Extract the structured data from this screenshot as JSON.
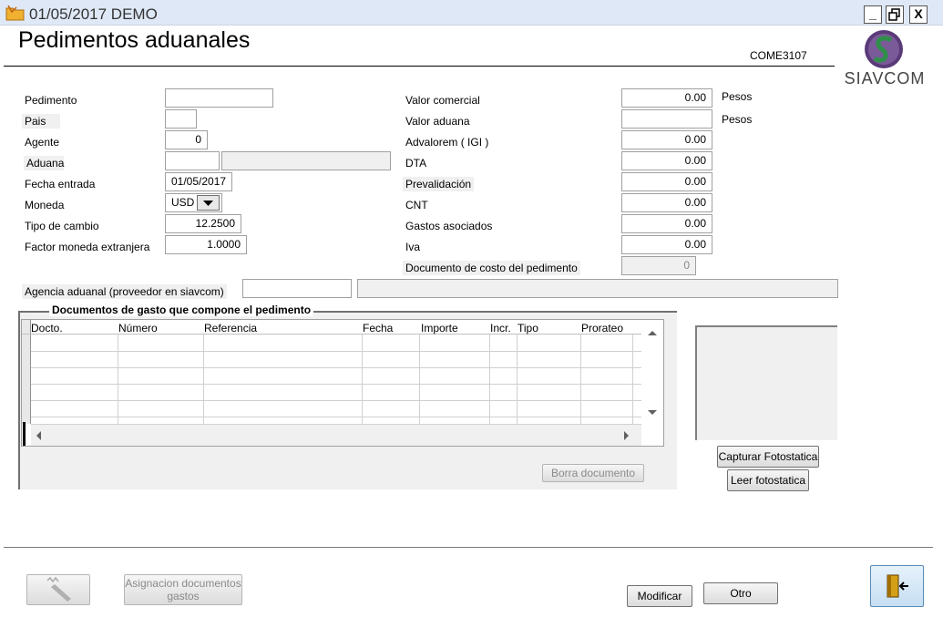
{
  "window": {
    "title": "01/05/2017  DEMO",
    "minimize": "_",
    "restore": "🗗",
    "close": "X"
  },
  "header": {
    "title": "Pedimentos aduanales",
    "code": "COME3107",
    "brand": "SIAVCOM"
  },
  "left_form": {
    "pedimento_label": "Pedimento",
    "pedimento_value": "",
    "pais_label": "Pais",
    "pais_value": "",
    "agente_label": "Agente",
    "agente_value": "0",
    "aduana_label": "Aduana",
    "aduana_value": "",
    "aduana_desc": "",
    "fecha_label": "Fecha entrada",
    "fecha_value": "01/05/2017",
    "moneda_label": "Moneda",
    "moneda_value": "USD",
    "tipo_cambio_label": "Tipo de cambio",
    "tipo_cambio_value": "12.2500",
    "factor_label": "Factor moneda extranjera",
    "factor_value": "1.0000"
  },
  "right_form": {
    "valor_comercial_label": "Valor comercial",
    "valor_comercial_value": "0.00",
    "valor_comercial_unit": "Pesos",
    "valor_aduana_label": "Valor aduana",
    "valor_aduana_value": "",
    "valor_aduana_unit": "Pesos",
    "advalorem_label": "Advalorem ( IGI )",
    "advalorem_value": "0.00",
    "dta_label": "DTA",
    "dta_value": "0.00",
    "prevalidacion_label": "Prevalidación",
    "prevalidacion_value": "0.00",
    "cnt_label": "CNT",
    "cnt_value": "0.00",
    "gastos_label": "Gastos asociados",
    "gastos_value": "0.00",
    "iva_label": "Iva",
    "iva_value": "0.00",
    "doc_costo_label": "Documento de costo del  pedimento",
    "doc_costo_value": "0"
  },
  "agencia": {
    "label": "Agencia aduanal (proveedor en siavcom)",
    "value": "",
    "desc": ""
  },
  "documents": {
    "group_title": "Documentos  de gasto  que compone el pedimento",
    "columns": [
      "Docto.",
      "Número",
      "Referencia",
      "Fecha",
      "Importe",
      "Incr.",
      "Tipo",
      "Prorateo"
    ],
    "borra_label": "Borra documento"
  },
  "foto": {
    "capturar_label": "Capturar Fotostatica",
    "leer_label": "Leer fotostatica"
  },
  "footer": {
    "asignacion_label": "Asignacion documentos gastos",
    "modificar_label": "Modificar",
    "otro_label": "Otro"
  },
  "icons": [
    "folder-icon",
    "scroll-up-icon",
    "scroll-down-icon",
    "scroll-left-icon",
    "scroll-right-icon",
    "dropdown-arrow-icon",
    "signature-icon",
    "exit-door-icon"
  ]
}
